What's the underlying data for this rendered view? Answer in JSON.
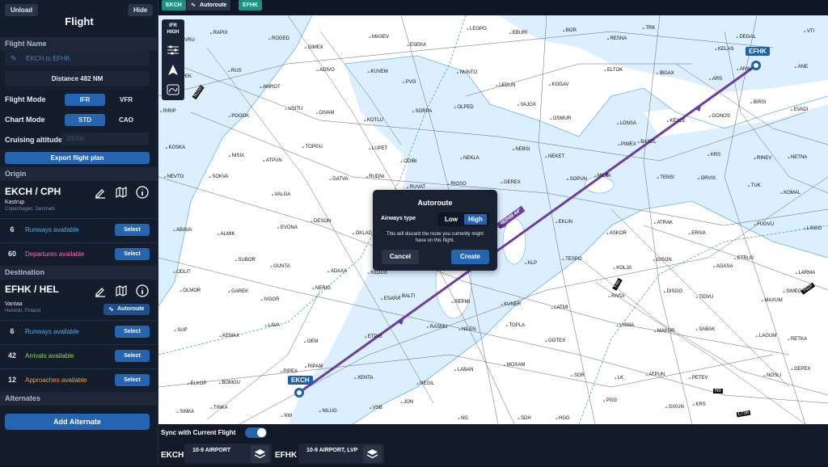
{
  "sidebar": {
    "unload_label": "Unload",
    "hide_label": "Hide",
    "title": "Flight",
    "flight_name_heading": "Flight Name",
    "flight_name_placeholder": "EKCH to EFHK",
    "distance": "Distance 482 NM",
    "flight_mode_label": "Flight Mode",
    "flight_mode_options": [
      "IFR",
      "VFR"
    ],
    "chart_mode_label": "Chart Mode",
    "chart_mode_options": [
      "STD",
      "CAO"
    ],
    "cruise_label": "Cruising altitude",
    "cruise_placeholder": "38000",
    "export_label": "Export flight plan",
    "origin_heading": "Origin",
    "origin": {
      "code": "EKCH / CPH",
      "name": "Kastrup",
      "location": "Copenhagen, Denmark",
      "rows": [
        {
          "count": "6",
          "label": "Runways available",
          "button": "Select",
          "color": "#5aa8e8"
        },
        {
          "count": "60",
          "label": "Departures available",
          "button": "Select",
          "color": "#e872b8"
        }
      ]
    },
    "destination_heading": "Destination",
    "destination": {
      "code": "EFHK / HEL",
      "name": "Vantaa",
      "location": "Helsinki, Finland",
      "autoroute_label": "Autoroute",
      "rows": [
        {
          "count": "6",
          "label": "Runways available",
          "button": "Select",
          "color": "#5aa8e8"
        },
        {
          "count": "42",
          "label": "Arrivals available",
          "button": "Select",
          "color": "#8fd16a"
        },
        {
          "count": "12",
          "label": "Approaches available",
          "button": "Select",
          "color": "#f0a050"
        }
      ]
    },
    "alternates_heading": "Alternates",
    "add_alternate_label": "Add Alternate"
  },
  "top_tags": [
    {
      "label": "EKCH",
      "color": "#1f8f80"
    },
    {
      "label": "Autoroute",
      "color": "#2a3548"
    },
    {
      "label": "EFHK",
      "color": "#1f8f80"
    }
  ],
  "map_tools": {
    "ifr_high_line1": "IFR",
    "ifr_high_line2": "HIGH"
  },
  "map": {
    "route_color": "#6a3fa0",
    "origin_badge": "EKCH",
    "dest_badge": "EFHK",
    "route_label": "482NM 44°",
    "airway_labels": [
      "N150",
      "Y40",
      "Y82F",
      "N9",
      "L736"
    ],
    "waypoints": [
      "GEVRU",
      "RAPIX",
      "ROGED",
      "GIMEX",
      "MASEV",
      "ESEKA",
      "LEGPO",
      "EBURI",
      "BOR",
      "RESNA",
      "TRK",
      "KELAS",
      "DEGAL",
      "VTI",
      "NEPEK",
      "RUS",
      "AMROT",
      "ADIVO",
      "KUVEM",
      "PVO",
      "NUNTO",
      "LEDUN",
      "KOGAV",
      "ELTOK",
      "IBGAX",
      "ARS",
      "ANW",
      "ANE",
      "RIRIP",
      "POGOK",
      "USITU",
      "DIVAM",
      "KOTLU",
      "SORPA",
      "OLPED",
      "VAJOX",
      "OSMUR",
      "LONSA",
      "KEXLE",
      "GONOS",
      "BIRSI",
      "EVADI",
      "KOSKA",
      "NISIX",
      "ATPUN",
      "TOPGU",
      "LUPET",
      "ODIBI",
      "NEKLA",
      "NEBSI",
      "NEKET",
      "PIMEX",
      "BASEL",
      "KRS",
      "RINEV",
      "NETNA",
      "NEVTO",
      "SOKVA",
      "VALGA",
      "GATVA",
      "RUDNI",
      "RUVAT",
      "RIGSO",
      "DEREX",
      "SOPUN",
      "MILTA",
      "TENSI",
      "ORVIX",
      "TUK",
      "KOMAL",
      "ABAVA",
      "ALMIK",
      "EVONA",
      "DESON",
      "OKLAD",
      "GELDA",
      "VARUS",
      "LEP",
      "EKLIN",
      "ASKOR",
      "ATRAK",
      "ERIVA",
      "FUGVU",
      "LISGO",
      "ODLIT",
      "SUBOR",
      "GUNTA",
      "ADAXA",
      "KEDUX",
      "GARSO",
      "VEDEN",
      "KLP",
      "TESPO",
      "KOLJA",
      "GISON",
      "AGASA",
      "ETRUS",
      "LARMA",
      "OLMOR",
      "GAREK",
      "IVGOR",
      "NERIG",
      "ESARA",
      "BALTI",
      "REPMI",
      "KUNER",
      "LATMI",
      "RIVDI",
      "DISGO",
      "TIDVU",
      "MAXUM",
      "SIMEG",
      "SUP",
      "KEMAX",
      "LAVA",
      "OEM",
      "ETPIG",
      "RASMU",
      "NILEN",
      "TOPLA",
      "GOTEX",
      "LISMA",
      "MAKUR",
      "SABAK",
      "LAGUM",
      "RETKA",
      "ELKOP",
      "BOMGU",
      "PIPEX",
      "RIPAM",
      "XENTA",
      "NEGIL",
      "LABAN",
      "MOXAM",
      "SOR",
      "LK",
      "ATPUN",
      "PETEV",
      "NOSLI",
      "DEPEX",
      "SINKA",
      "TINKA",
      "NW",
      "NILUG",
      "VSB",
      "JON",
      "NG",
      "SDH",
      "HGG",
      "PGG",
      "GIXUN",
      "KRS"
    ]
  },
  "dialog": {
    "title": "Autoroute",
    "airways_label": "Airways type",
    "options": [
      "Low",
      "High"
    ],
    "message": "This will discard the route you currently might have on this flight.",
    "cancel_label": "Cancel",
    "create_label": "Create"
  },
  "bottom": {
    "sync_label": "Sync with Current Flight",
    "sync_on": true,
    "origin_code": "EKCH",
    "origin_chart": "10-9 AIRPORT",
    "dest_code": "EFHK",
    "dest_chart": "10-9 AIRPORT, LVP"
  }
}
